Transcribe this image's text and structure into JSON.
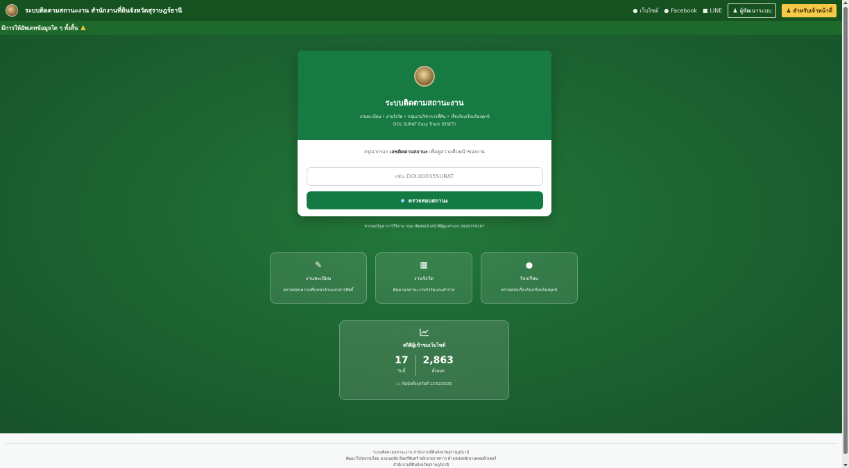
{
  "navbar": {
    "title": "ระบบติดตามสถานะงาน สำนักงานที่ดินจังหวัดสุราษฎร์ธานี",
    "links": {
      "website": "เว็บไซต์",
      "facebook": "Facebook",
      "line": "LINE"
    },
    "developer_label": "ผู้พัฒนาระบบ",
    "staff_label": "สำหรับเจ้าหน้าที่"
  },
  "marquee": {
    "text": "มีการให้อัพเดทข้อมูลใด ๆ ทั้งสิ้น"
  },
  "card": {
    "title": "ระบบติดตามสถานะงาน",
    "subtitle": "งานทะเบียน • งานรังวัด • กลุ่มงานวิชาการที่ดิน • เรื่องร้องเรียนร้องทุกข์",
    "code": "DOL.SURAT Easy Track (DSET)",
    "prompt_before": "กรุณากรอก",
    "prompt_bold": "เลขติดตามสถานะ",
    "prompt_after": "เพื่อดูความคืบหน้าของงาน",
    "input_placeholder": "เช่น DOL00035SURAT",
    "check_button": "ตรวจสอบสถานะ"
  },
  "contact": {
    "text": "หากพบปัญหาการใช้งาน กรุณาติดต่อเจ้าหน้าที่ผู้ดูแลระบบ 0926709167"
  },
  "services": [
    {
      "title": "งานทะเบียน",
      "desc": "ตรวจสอบความคืบหน้าด้านเอกสารสิทธิ์"
    },
    {
      "title": "งานรังวัด",
      "desc": "ติดตามสถานะงานรังวัดและสำรวจ"
    },
    {
      "title": "ร้องเรียน",
      "desc": "ตรวจสอบเรื่องร้องเรียนร้องทุกข์"
    }
  ],
  "stats": {
    "title": "สถิติผู้เข้าชมเว็บไซต์",
    "today_value": "17",
    "today_label": "วันนี้",
    "total_value": "2,863",
    "total_label": "ทั้งหมด",
    "since": "เริ่มนับตั้งแต่วันที่ 12/02/2026"
  },
  "footer": {
    "line1": "ระบบติดตามสถานะงาน สำนักงานที่ดินจังหวัดสุราษฎร์ธานี",
    "line2": "พัฒนาโปรแกรมโดย นายณธุชัย อินทร์จันทร์ พนักงานราชการ ตำแหน่งพนักงานคอมพิวเตอร์",
    "line3": "สำนักงานที่ดินจังหวัดสุราษฎร์ธานี"
  },
  "colors": {
    "brand_green": "#177a43",
    "button_green": "#137a44",
    "staff_yellow": "#f7c948",
    "warning": "#f6c343"
  }
}
